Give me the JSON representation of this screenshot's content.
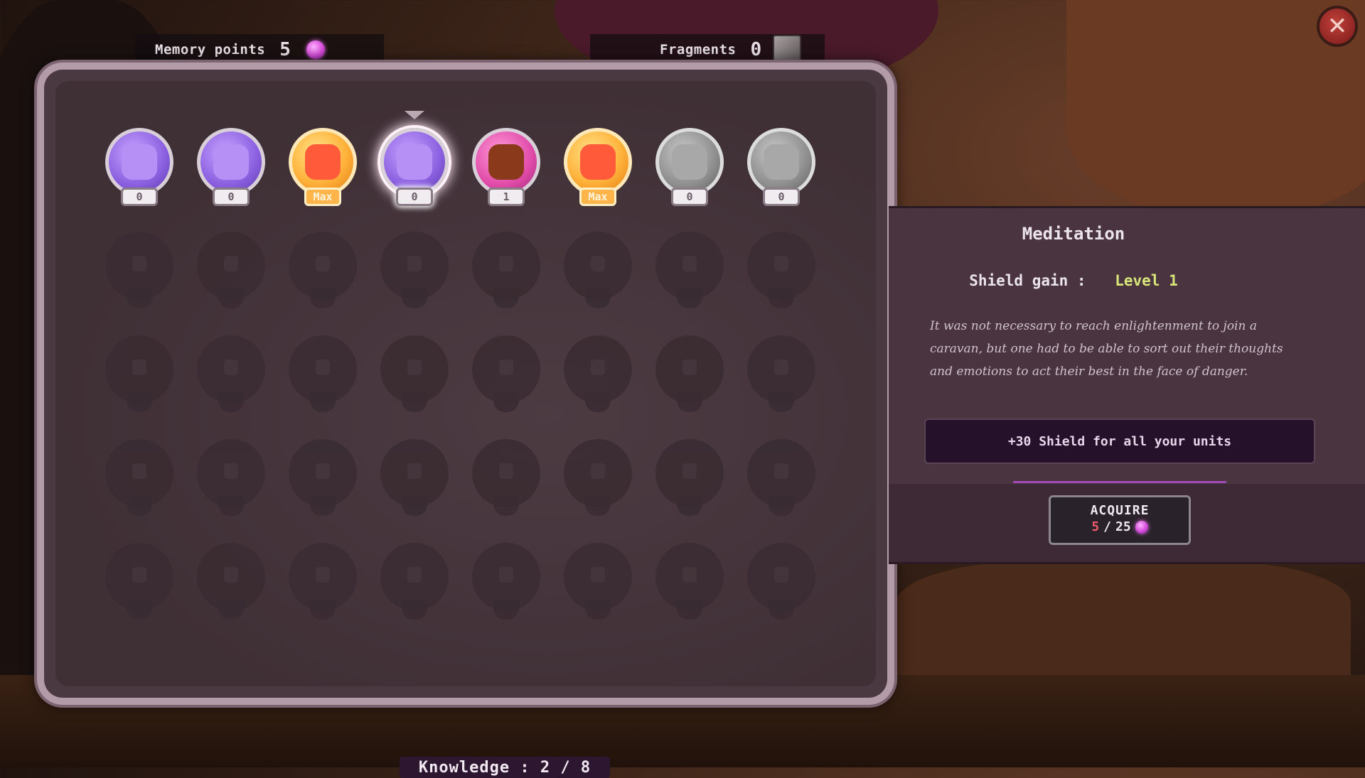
{
  "header": {
    "memory_label": "Memory points",
    "memory_value": "5",
    "fragments_label": "Fragments",
    "fragments_value": "0"
  },
  "close_icon": "close-icon",
  "skills": [
    {
      "icon": "blob-icon",
      "badge": "0",
      "color": "purple"
    },
    {
      "icon": "sword-icon",
      "badge": "0",
      "color": "purple"
    },
    {
      "icon": "heart-icon",
      "badge": "Max",
      "color": "gold"
    },
    {
      "icon": "shield-icon",
      "badge": "0",
      "color": "purple",
      "selected": true
    },
    {
      "icon": "beast-icon",
      "badge": "1",
      "color": "pink"
    },
    {
      "icon": "boot-icon",
      "badge": "Max",
      "color": "gold"
    },
    {
      "icon": "rock-icon",
      "badge": "0",
      "color": "grey"
    },
    {
      "icon": "sun-icon",
      "badge": "0",
      "color": "grey"
    }
  ],
  "knowledge": "Knowledge : 2 / 8",
  "detail": {
    "title": "Meditation",
    "stat_name": "Shield gain :",
    "stat_level": "Level 1",
    "description": "It was not necessary to reach enlightenment to join a caravan, but one had to be able to sort out their thoughts and emotions to act their best in the face of danger.",
    "effect": "+30 Shield for all your units",
    "acquire_label": "ACQUIRE",
    "cost_have": "5",
    "cost_sep": "/",
    "cost_need": "25"
  },
  "colors": {
    "accent": "#a04ab8",
    "gem": "#d44bd8",
    "level": "#d8e67a",
    "insufficient": "#f05a6a"
  }
}
